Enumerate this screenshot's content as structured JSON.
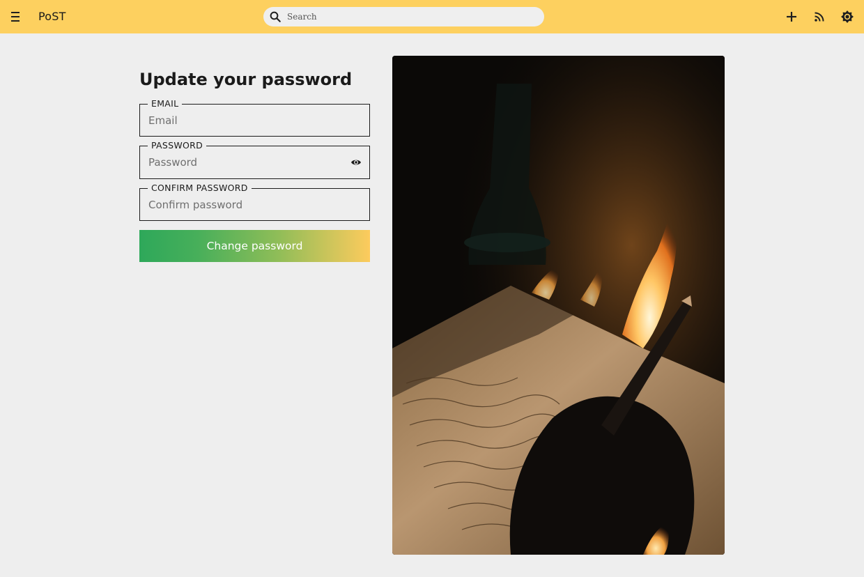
{
  "topbar": {
    "brand": "PoST",
    "search_placeholder": "Search",
    "icons": [
      "menu-icon",
      "search-icon",
      "plus-icon",
      "rss-icon",
      "brightness-icon"
    ]
  },
  "form": {
    "title": "Update your password",
    "email": {
      "label": "EMAIL",
      "placeholder": "Email"
    },
    "password": {
      "label": "PASSWORD",
      "placeholder": "Password"
    },
    "confirm": {
      "label": "CONFIRM PASSWORD",
      "placeholder": "Confirm password"
    },
    "submit_label": "Change password"
  },
  "colors": {
    "topbar": "#fdd05f",
    "background": "#eeeeee",
    "button_gradient_start": "#2ea85a",
    "button_gradient_end": "#fdcb5d"
  }
}
